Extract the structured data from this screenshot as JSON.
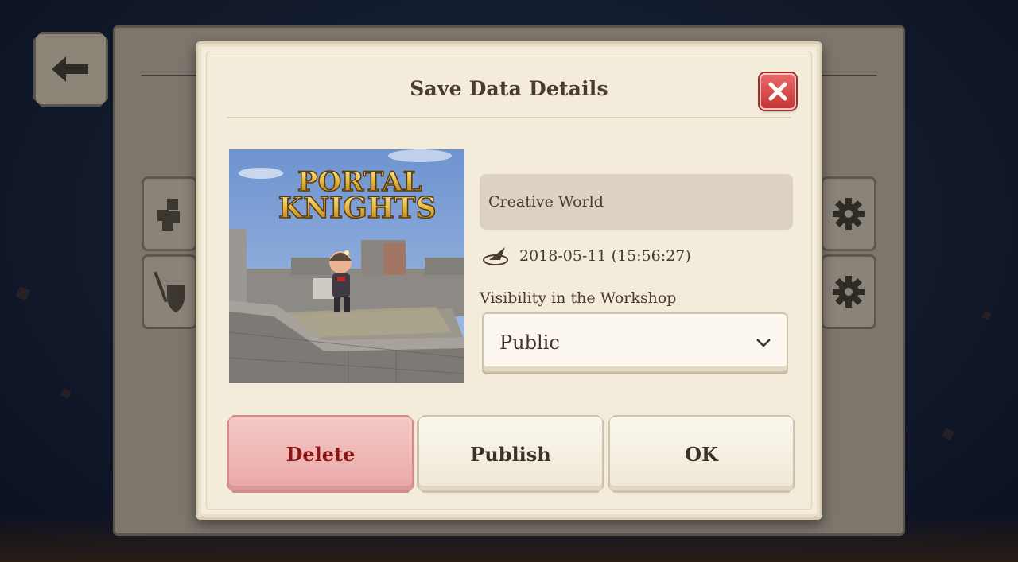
{
  "dialog": {
    "title": "Save Data Details",
    "close_icon": "close-icon",
    "world_name": "Creative World",
    "date_icon": "sundial-icon",
    "saved_at": "2018-05-11 (15:56:27)",
    "visibility_label": "Visibility in the Workshop",
    "visibility_value": "Public",
    "thumbnail": {
      "logo_line1": "PORTAL",
      "logo_line2": "KNIGHTS"
    },
    "buttons": {
      "delete": "Delete",
      "publish": "Publish",
      "ok": "OK"
    }
  },
  "background": {
    "back_icon": "arrow-left-icon",
    "side_icons": [
      "blocks-icon",
      "sword-shield-icon",
      "gear-icon",
      "gear-icon"
    ]
  },
  "colors": {
    "dialog_bg": "#f4ecdb",
    "title_text": "#4a3b2d",
    "delete_text": "#8c1616",
    "delete_bg": "#f4c9c6",
    "close_bg": "#d94b4b"
  }
}
